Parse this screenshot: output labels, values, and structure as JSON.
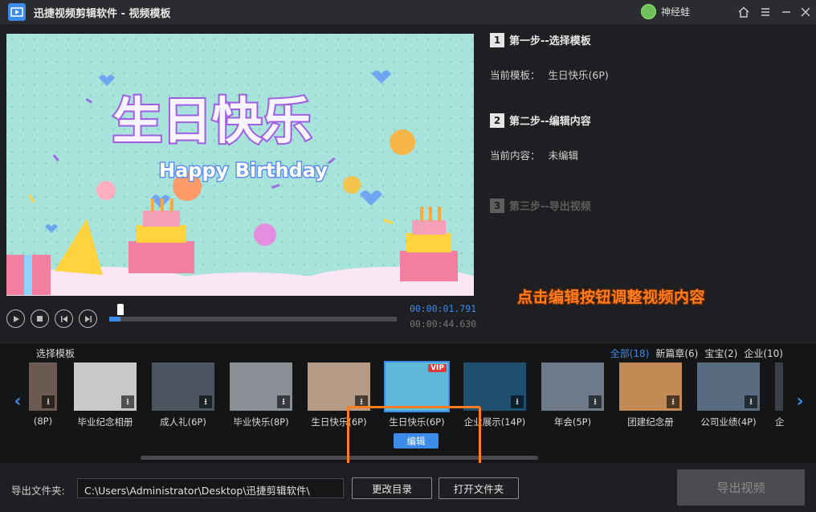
{
  "window": {
    "title": "迅捷视频剪辑软件 - 视频模板",
    "user_name": "神经蛙"
  },
  "preview": {
    "title_art": "生日快乐",
    "subtitle_art": "Happy Birthday",
    "time_current": "00:00:01.791",
    "time_total": "00:00:44.630",
    "progress_fraction": 0.04
  },
  "steps": {
    "step1_num": "1",
    "step1_title": "第一步--选择模板",
    "step1_label": "当前模板：",
    "step1_value": "生日快乐(6P)",
    "step2_num": "2",
    "step2_title": "第二步--编辑内容",
    "step2_label": "当前内容：",
    "step2_value": "未编辑",
    "step3_num": "3",
    "step3_title": "第三步--导出视频",
    "hint": "点击编辑按钮调整视频内容"
  },
  "templates": {
    "section_label": "选择模板",
    "filters": [
      "全部(18)",
      "新篇章(6)",
      "宝宝(2)",
      "企业(10)"
    ],
    "items": [
      {
        "label": "(8P)",
        "color": "#6b5a52"
      },
      {
        "label": "毕业纪念相册",
        "color": "#c9c9c9"
      },
      {
        "label": "成人礼(6P)",
        "color": "#4a5560"
      },
      {
        "label": "毕业快乐(8P)",
        "color": "#8a8f96"
      },
      {
        "label": "生日快乐(6P)",
        "color": "#b59a85"
      },
      {
        "label": "生日快乐(6P)",
        "color": "#5fb8d8"
      },
      {
        "label": "企业展示(14P)",
        "color": "#1f4f6e"
      },
      {
        "label": "年会(5P)",
        "color": "#6e7a8a"
      },
      {
        "label": "团建纪念册",
        "color": "#c28a55"
      },
      {
        "label": "公司业绩(4P)",
        "color": "#596b80"
      },
      {
        "label": "企",
        "color": "#3b4048"
      }
    ],
    "download_icon": "download-icon",
    "vip_badge": "VIP",
    "edit_label": "编辑"
  },
  "bottom": {
    "out_folder_label": "导出文件夹:",
    "path": "C:\\Users\\Administrator\\Desktop\\迅捷剪辑软件\\",
    "change_dir_label": "更改目录",
    "open_folder_label": "打开文件夹",
    "export_label": "导出视频"
  },
  "colors": {
    "accent": "#3d8be8",
    "hint_orange": "#ff7c1f",
    "background": "#1e1f22"
  }
}
